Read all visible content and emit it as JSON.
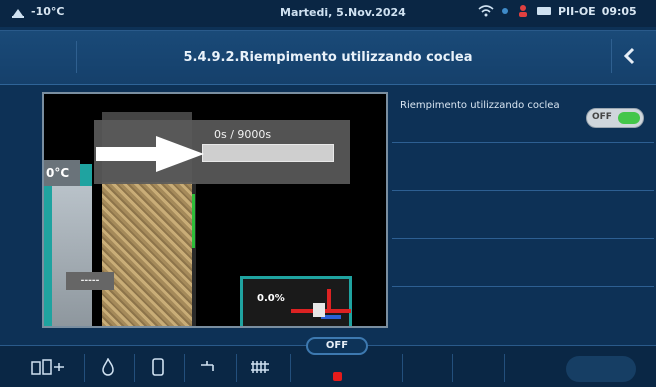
{
  "status": {
    "outdoor_temp": "-10°C",
    "date": "Martedi, 5.Nov.2024",
    "mode": "PII-OE",
    "time": "09:05"
  },
  "header": {
    "title": "5.4.9.2.Riempimento utilizzando coclea"
  },
  "preview": {
    "progress_text": "0s / 9000s",
    "boiler_temp": "0°C",
    "mixer_percent": "0.0%"
  },
  "settings": [
    {
      "label": "Riempimento utilizzando coclea",
      "toggle_text": "OFF",
      "state": "off"
    }
  ],
  "bottom": {
    "off_label": "OFF"
  },
  "colors": {
    "accent_green": "#43c64a",
    "teal": "#1fa3a0",
    "alarm_red": "#e51b1b"
  }
}
